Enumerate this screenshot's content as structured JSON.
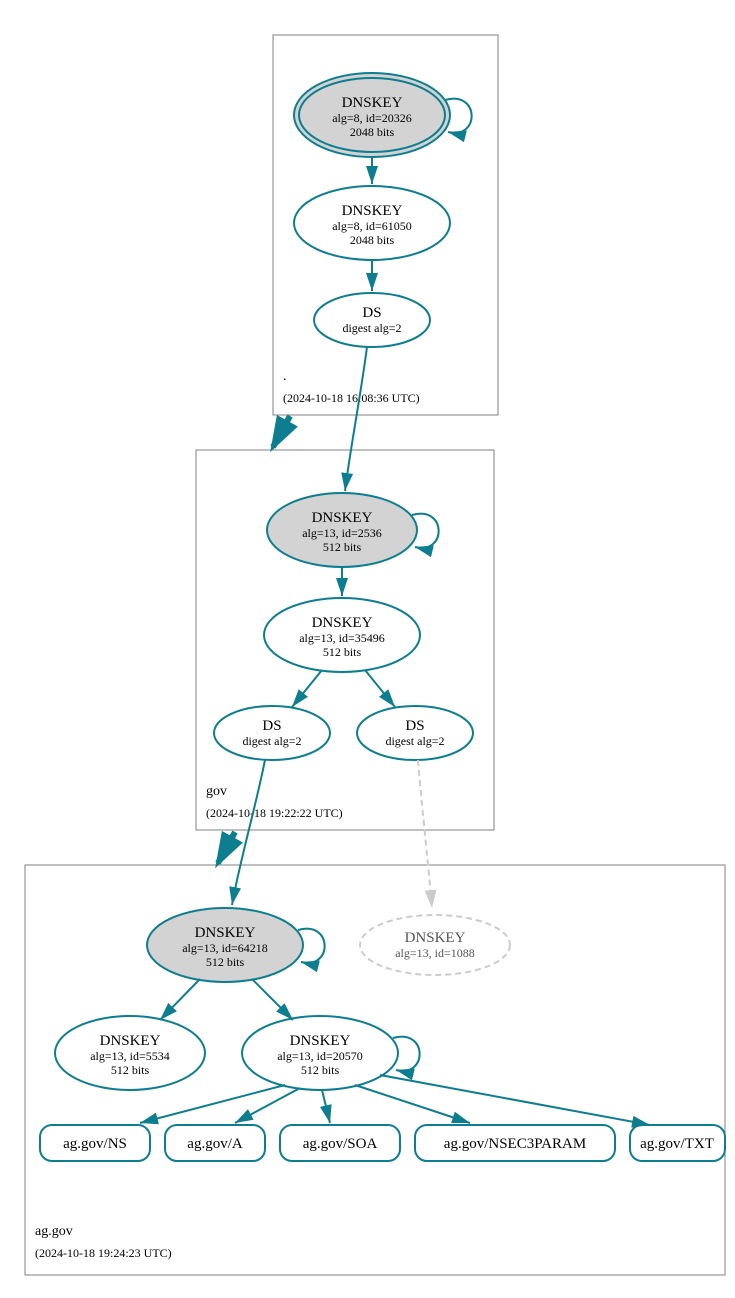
{
  "zones": [
    {
      "name": ".",
      "timestamp": "(2024-10-18 16:08:36 UTC)"
    },
    {
      "name": "gov",
      "timestamp": "(2024-10-18 19:22:22 UTC)"
    },
    {
      "name": "ag.gov",
      "timestamp": "(2024-10-18 19:24:23 UTC)"
    }
  ],
  "nodes": {
    "root_ksk": {
      "title": "DNSKEY",
      "line2": "alg=8, id=20326",
      "line3": "2048 bits"
    },
    "root_zsk": {
      "title": "DNSKEY",
      "line2": "alg=8, id=61050",
      "line3": "2048 bits"
    },
    "root_ds": {
      "title": "DS",
      "line2": "digest alg=2"
    },
    "gov_ksk": {
      "title": "DNSKEY",
      "line2": "alg=13, id=2536",
      "line3": "512 bits"
    },
    "gov_zsk": {
      "title": "DNSKEY",
      "line2": "alg=13, id=35496",
      "line3": "512 bits"
    },
    "gov_ds1": {
      "title": "DS",
      "line2": "digest alg=2"
    },
    "gov_ds2": {
      "title": "DS",
      "line2": "digest alg=2"
    },
    "ag_ksk": {
      "title": "DNSKEY",
      "line2": "alg=13, id=64218",
      "line3": "512 bits"
    },
    "ag_missing": {
      "title": "DNSKEY",
      "line2": "alg=13, id=1088"
    },
    "ag_zsk1": {
      "title": "DNSKEY",
      "line2": "alg=13, id=5534",
      "line3": "512 bits"
    },
    "ag_zsk2": {
      "title": "DNSKEY",
      "line2": "alg=13, id=20570",
      "line3": "512 bits"
    },
    "rr_ns": "ag.gov/NS",
    "rr_a": "ag.gov/A",
    "rr_soa": "ag.gov/SOA",
    "rr_nsec3": "ag.gov/NSEC3PARAM",
    "rr_txt": "ag.gov/TXT"
  },
  "colors": {
    "teal": "#0d7e8f",
    "gray_fill": "#d3d3d3",
    "light_gray": "#cccccc",
    "box_stroke": "#808080"
  }
}
